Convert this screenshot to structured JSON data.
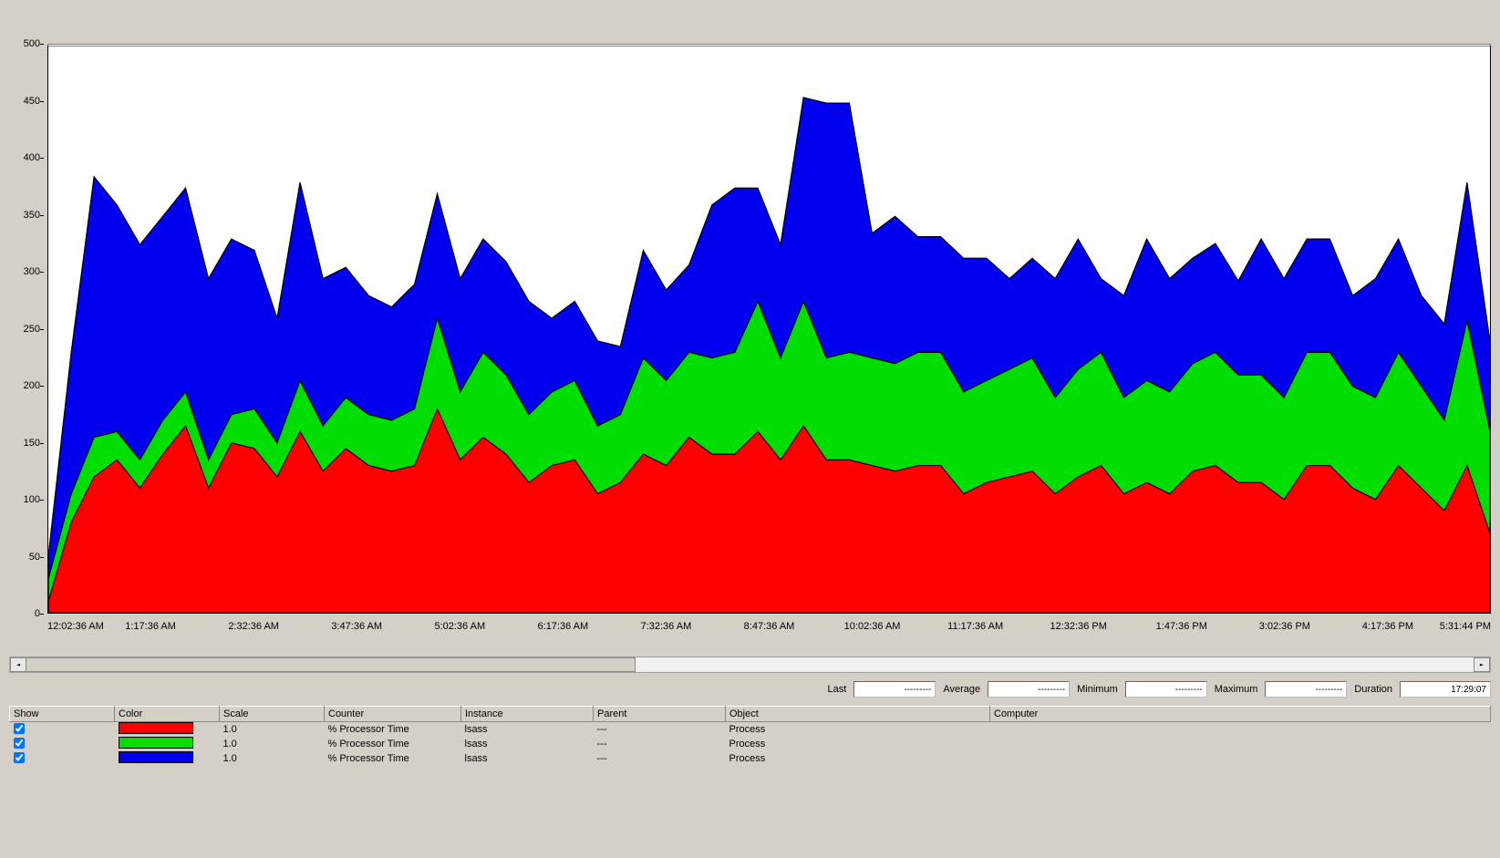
{
  "chart_data": {
    "type": "area",
    "ylim": [
      0,
      500
    ],
    "x": [
      0,
      1,
      2,
      3,
      4,
      5,
      6,
      7,
      8,
      9,
      10,
      11,
      12,
      13,
      14,
      15,
      16,
      17,
      18,
      19,
      20,
      21,
      22,
      23,
      24,
      25,
      26,
      27,
      28,
      29,
      30,
      31,
      32,
      33,
      34,
      35,
      36,
      37,
      38,
      39,
      40,
      41,
      42,
      43,
      44,
      45,
      46,
      47,
      48,
      49,
      50,
      51,
      52,
      53,
      54,
      55,
      56,
      57,
      58,
      59,
      60,
      61,
      62,
      63
    ],
    "x_tick_labels": [
      "12:02:36 AM",
      "1:17:36 AM",
      "2:32:36 AM",
      "3:47:36 AM",
      "5:02:36 AM",
      "6:17:36 AM",
      "7:32:36 AM",
      "8:47:36 AM",
      "10:02:36 AM",
      "11:17:36 AM",
      "12:32:36 PM",
      "1:47:36 PM",
      "3:02:36 PM",
      "4:17:36 PM",
      "5:31:44 PM"
    ],
    "y_ticks": [
      0,
      50,
      100,
      150,
      200,
      250,
      300,
      350,
      400,
      450,
      500
    ],
    "series": [
      {
        "name": "red",
        "color": "#FF0000",
        "values": [
          10,
          80,
          120,
          135,
          110,
          140,
          165,
          110,
          150,
          145,
          120,
          160,
          125,
          145,
          130,
          125,
          130,
          180,
          135,
          155,
          140,
          115,
          130,
          135,
          105,
          115,
          140,
          130,
          155,
          140,
          140,
          160,
          135,
          165,
          135,
          135,
          130,
          125,
          130,
          130,
          105,
          115,
          120,
          125,
          105,
          120,
          130,
          105,
          115,
          105,
          125,
          130,
          115,
          115,
          100,
          130,
          130,
          110,
          100,
          130,
          110,
          90,
          130,
          70
        ]
      },
      {
        "name": "green",
        "color": "#00DD00",
        "values": [
          30,
          105,
          155,
          160,
          135,
          170,
          195,
          135,
          175,
          180,
          150,
          205,
          165,
          190,
          175,
          170,
          180,
          260,
          195,
          230,
          210,
          175,
          195,
          205,
          165,
          175,
          225,
          205,
          230,
          225,
          230,
          275,
          225,
          275,
          225,
          230,
          225,
          220,
          230,
          230,
          195,
          205,
          215,
          225,
          190,
          215,
          230,
          190,
          205,
          195,
          220,
          230,
          210,
          210,
          190,
          230,
          230,
          200,
          190,
          230,
          200,
          170,
          258,
          160
        ]
      },
      {
        "name": "blue",
        "color": "#0000EE",
        "values": [
          50,
          230,
          385,
          360,
          325,
          350,
          375,
          295,
          330,
          320,
          260,
          380,
          295,
          305,
          280,
          270,
          290,
          370,
          295,
          330,
          310,
          275,
          260,
          275,
          240,
          235,
          320,
          285,
          307,
          360,
          375,
          375,
          325,
          455,
          450,
          450,
          335,
          350,
          332,
          332,
          313,
          313,
          295,
          313,
          295,
          330,
          295,
          280,
          330,
          295,
          313,
          326,
          293,
          330,
          295,
          330,
          330,
          280,
          295,
          330,
          280,
          255,
          380,
          240
        ]
      }
    ]
  },
  "stats": {
    "labels": {
      "last": "Last",
      "avg": "Average",
      "min": "Minimum",
      "max": "Maximum",
      "dur": "Duration"
    },
    "values": {
      "last": "---------",
      "avg": "---------",
      "min": "---------",
      "max": "---------",
      "dur": "17:29:07"
    }
  },
  "list": {
    "headers": [
      "Show",
      "Color",
      "Scale",
      "Counter",
      "Instance",
      "Parent",
      "Object",
      "Computer"
    ],
    "rows": [
      {
        "checked": true,
        "color": "#FF0000",
        "scale": "1.0",
        "counter": "% Processor Time",
        "instance": "lsass",
        "parent": "---",
        "object": "Process",
        "computer": ""
      },
      {
        "checked": true,
        "color": "#00DD00",
        "scale": "1.0",
        "counter": "% Processor Time",
        "instance": "lsass",
        "parent": "---",
        "object": "Process",
        "computer": ""
      },
      {
        "checked": true,
        "color": "#0000EE",
        "scale": "1.0",
        "counter": "% Processor Time",
        "instance": "lsass",
        "parent": "---",
        "object": "Process",
        "computer": ""
      }
    ]
  }
}
